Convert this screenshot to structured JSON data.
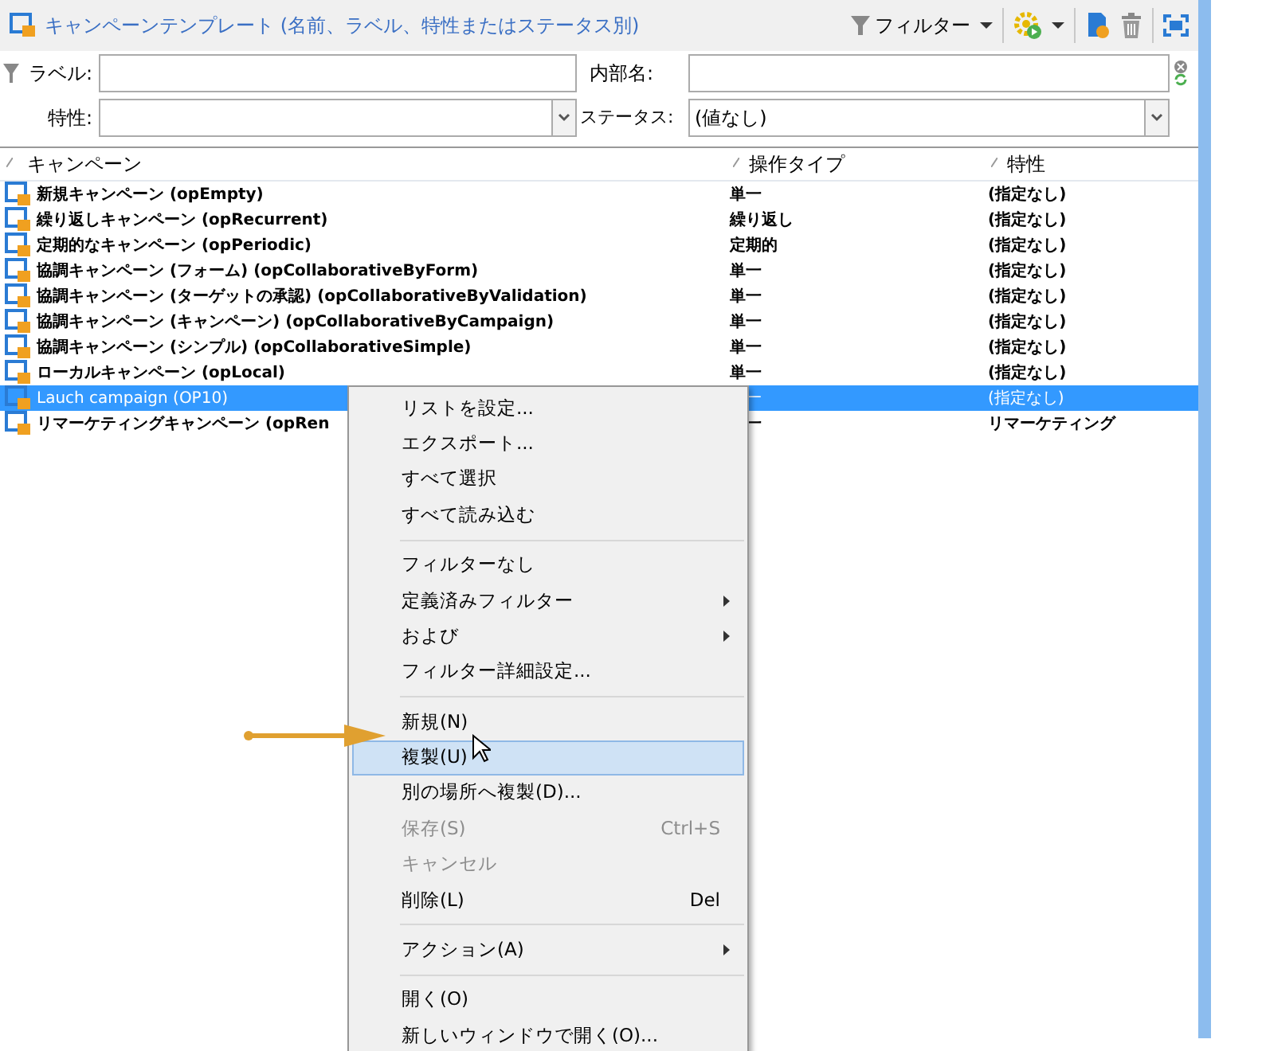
{
  "toolbar": {
    "title": "キャンペーンテンプレート (名前、ラベル、特性またはステータス別)",
    "filter_button": "フィルター"
  },
  "filters": {
    "label": {
      "label": "ラベル:"
    },
    "internal_name": {
      "label": "内部名:"
    },
    "trait": {
      "label": "特性:"
    },
    "status": {
      "label": "ステータス:",
      "value": "(値なし)"
    }
  },
  "table": {
    "columns": [
      "キャンペーン",
      "操作タイプ",
      "特性"
    ],
    "rows": [
      {
        "name": "新規キャンペーン (opEmpty)",
        "op_type": "単一",
        "trait": "(指定なし)",
        "selected": false
      },
      {
        "name": "繰り返しキャンペーン (opRecurrent)",
        "op_type": "繰り返し",
        "trait": "(指定なし)",
        "selected": false
      },
      {
        "name": "定期的なキャンペーン (opPeriodic)",
        "op_type": "定期的",
        "trait": "(指定なし)",
        "selected": false
      },
      {
        "name": "協調キャンペーン (フォーム) (opCollaborativeByForm)",
        "op_type": "単一",
        "trait": "(指定なし)",
        "selected": false
      },
      {
        "name": "協調キャンペーン (ターゲットの承認) (opCollaborativeByValidation)",
        "op_type": "単一",
        "trait": "(指定なし)",
        "selected": false
      },
      {
        "name": "協調キャンペーン (キャンペーン) (opCollaborativeByCampaign)",
        "op_type": "単一",
        "trait": "(指定なし)",
        "selected": false
      },
      {
        "name": "協調キャンペーン (シンプル) (opCollaborativeSimple)",
        "op_type": "単一",
        "trait": "(指定なし)",
        "selected": false
      },
      {
        "name": "ローカルキャンペーン (opLocal)",
        "op_type": "単一",
        "trait": "(指定なし)",
        "selected": false
      },
      {
        "name": "Lauch campaign (OP10)",
        "op_type": "一",
        "trait": "(指定なし)",
        "selected": true
      },
      {
        "name": "リマーケティングキャンペーン (opRen",
        "op_type": "一",
        "trait": "リマーケティング",
        "selected": false
      }
    ]
  },
  "context_menu": [
    {
      "kind": "item",
      "label": "リストを設定...",
      "disabled": false,
      "submenu": false,
      "selected": false
    },
    {
      "kind": "item",
      "label": "エクスポート...",
      "disabled": false,
      "submenu": false,
      "selected": false
    },
    {
      "kind": "item",
      "label": "すべて選択",
      "disabled": false,
      "submenu": false,
      "selected": false
    },
    {
      "kind": "item",
      "label": "すべて読み込む",
      "disabled": false,
      "submenu": false,
      "selected": false
    },
    {
      "kind": "separator"
    },
    {
      "kind": "item",
      "label": "フィルターなし",
      "disabled": false,
      "submenu": false,
      "selected": false
    },
    {
      "kind": "item",
      "label": "定義済みフィルター",
      "disabled": false,
      "submenu": true,
      "selected": false
    },
    {
      "kind": "item",
      "label": "および",
      "disabled": false,
      "submenu": true,
      "selected": false
    },
    {
      "kind": "item",
      "label": "フィルター詳細設定...",
      "disabled": false,
      "submenu": false,
      "selected": false
    },
    {
      "kind": "separator"
    },
    {
      "kind": "item",
      "label": "新規(N)",
      "disabled": false,
      "submenu": false,
      "selected": false
    },
    {
      "kind": "item",
      "label": "複製(U)",
      "disabled": false,
      "submenu": false,
      "selected": true
    },
    {
      "kind": "item",
      "label": "別の場所へ複製(D)...",
      "disabled": false,
      "submenu": false,
      "selected": false
    },
    {
      "kind": "item",
      "label": "保存(S)",
      "shortcut": "Ctrl+S",
      "disabled": true,
      "submenu": false,
      "selected": false
    },
    {
      "kind": "item",
      "label": "キャンセル",
      "disabled": true,
      "submenu": false,
      "selected": false
    },
    {
      "kind": "item",
      "label": "削除(L)",
      "shortcut": "Del",
      "disabled": false,
      "submenu": false,
      "selected": false
    },
    {
      "kind": "separator"
    },
    {
      "kind": "item",
      "label": "アクション(A)",
      "disabled": false,
      "submenu": true,
      "selected": false
    },
    {
      "kind": "separator"
    },
    {
      "kind": "item",
      "label": "開く(O)",
      "disabled": false,
      "submenu": false,
      "selected": false
    },
    {
      "kind": "item",
      "label": "新しいウィンドウで開く(O)...",
      "disabled": false,
      "submenu": false,
      "selected": false
    }
  ]
}
